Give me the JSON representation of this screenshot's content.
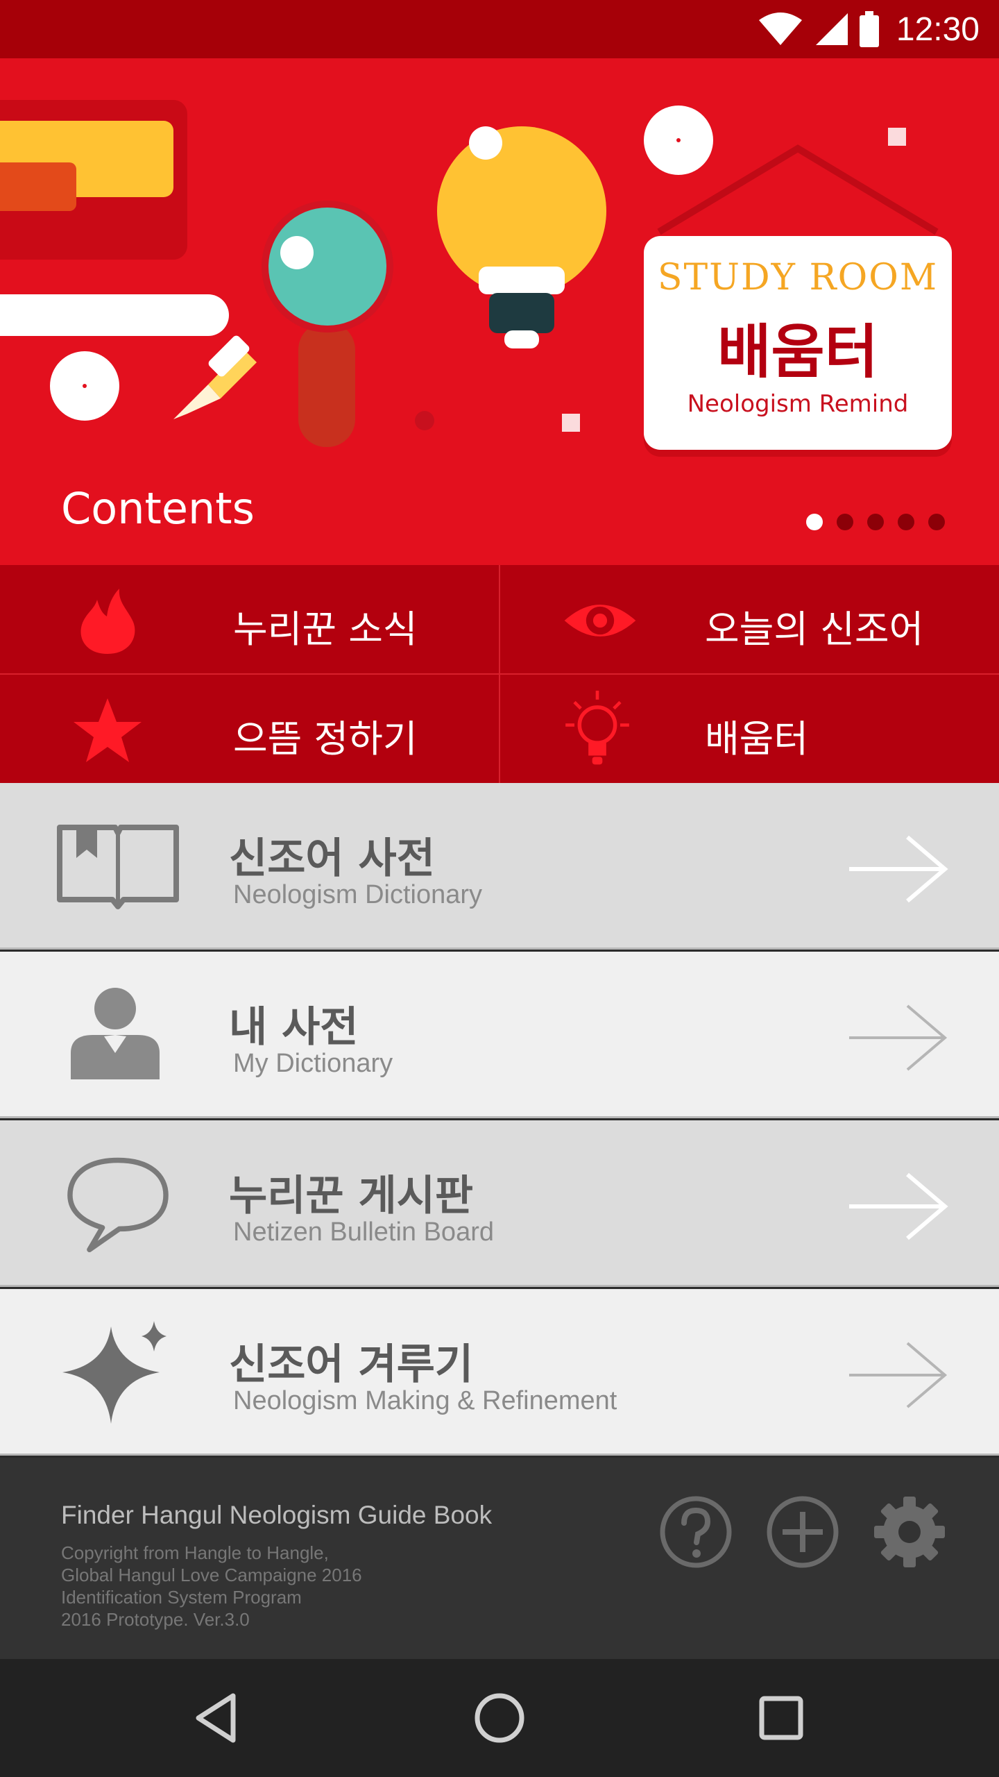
{
  "status_bar": {
    "time": "12:30",
    "icons": [
      "wifi-icon",
      "cell-signal-icon",
      "battery-icon"
    ]
  },
  "banner": {
    "title": "Contents",
    "sign": {
      "line1": "STUDY ROOM",
      "line2": "배움터",
      "line3": "Neologism Remind"
    },
    "page_count": 5,
    "active_page": 1
  },
  "quick_menu": [
    {
      "label": "누리꾼 소식",
      "icon": "flame-icon"
    },
    {
      "label": "오늘의 신조어",
      "icon": "eye-icon"
    },
    {
      "label": "으뜸 정하기",
      "icon": "star-icon"
    },
    {
      "label": "배움터",
      "icon": "lightbulb-icon"
    }
  ],
  "menu": [
    {
      "title": "신조어 사전",
      "subtitle": "Neologism Dictionary",
      "icon": "book-icon"
    },
    {
      "title": "내 사전",
      "subtitle": "My Dictionary",
      "icon": "person-icon"
    },
    {
      "title": "누리꾼 게시판",
      "subtitle": "Netizen Bulletin Board",
      "icon": "speech-bubble-icon"
    },
    {
      "title": "신조어 겨루기",
      "subtitle": "Neologism Making & Refinement",
      "icon": "sparkle-icon"
    }
  ],
  "footer": {
    "title": "Finder Hangul Neologism Guide Book",
    "lines": [
      "Copyright from Hangle to Hangle,",
      "Global Hangul Love Campaigne 2016",
      "Identification System Program",
      "2016 Prototype. Ver.3.0"
    ],
    "icons": [
      "help-icon",
      "add-icon",
      "settings-icon"
    ]
  },
  "colors": {
    "brand_red": "#e3101e",
    "dark_red": "#b3000e",
    "status_red": "#a60008"
  }
}
